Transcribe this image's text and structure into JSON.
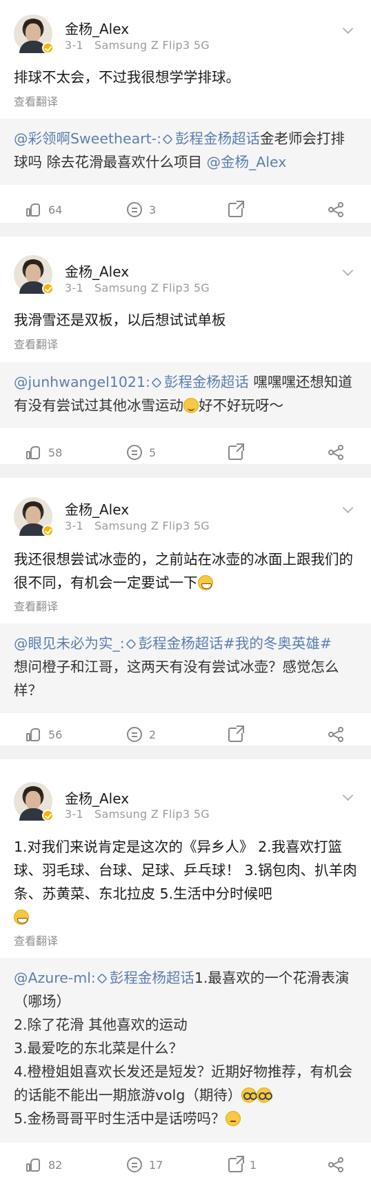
{
  "author": "金杨_Alex",
  "translate_label": "查看翻译",
  "posts": [
    {
      "date": "3-1",
      "device": "Samsung Z Flip3 5G",
      "text": "排球不太会，不过我很想学学排球。",
      "quote": {
        "mention": "@彩领啊Sweetheart-:",
        "topic": "彭程金杨超话",
        "body": "金老师会打排球吗 除去花滑最喜欢什么项目",
        "tail_mention": "@金杨_Alex"
      },
      "likes": "64",
      "comments": "3",
      "reposts": ""
    },
    {
      "date": "3-1",
      "device": "Samsung Z Flip3 5G",
      "text": "我滑雪还是双板，以后想试试单板",
      "quote": {
        "mention": "@junhwangel1021:",
        "topic": "彭程金杨超话",
        "body": " 嘿嘿嘿还想知道有没有尝试过其他冰雪运动",
        "body2": "好不好玩呀～"
      },
      "likes": "58",
      "comments": "5",
      "reposts": ""
    },
    {
      "date": "3-1",
      "device": "Samsung Z Flip3 5G",
      "text": "我还很想尝试冰壶的，之前站在冰壶的冰面上跟我们的很不同，有机会一定要试一下",
      "quote": {
        "mention": "@眼见未必为实_:",
        "topic": "彭程金杨超话",
        "hashtag": "#我的冬奥英雄#",
        "body": "想问橙子和江哥，这两天有没有尝试冰壶？感觉怎么样？"
      },
      "likes": "56",
      "comments": "2",
      "reposts": ""
    },
    {
      "date": "3-1",
      "device": "Samsung Z Flip3 5G",
      "text": "1.对我们来说肯定是这次的《异乡人》 2.我喜欢打篮球、羽毛球、台球、足球、乒乓球！ 3.锅包肉、扒羊肉条、苏黄菜、东北拉皮 5.生活中分时候吧",
      "quote": {
        "mention": "@Azure-ml:",
        "topic": "彭程金杨超话",
        "line1": "1.最喜欢的一个花滑表演（哪场）",
        "line2": "2.除了花滑 其他喜欢的运动",
        "line3": "3.最爱吃的东北菜是什么？",
        "line4": "4.橙橙姐姐喜欢长发还是短发？近期好物推荐，有机会的话能不能出一期旅游volg（期待）",
        "line5": "5.金杨哥哥平时生活中是话唠吗？"
      },
      "likes": "82",
      "comments": "17",
      "reposts": "1"
    }
  ],
  "colors": {
    "link": "#5b7fb0",
    "meta": "#9b9b9b",
    "bg": "#f2f2f2",
    "quote_bg": "#f5f5f5"
  },
  "icons": [
    "like-icon",
    "comment-icon",
    "repost-icon",
    "share-icon",
    "chevron-down-icon",
    "verified-badge-icon",
    "super-topic-icon"
  ]
}
